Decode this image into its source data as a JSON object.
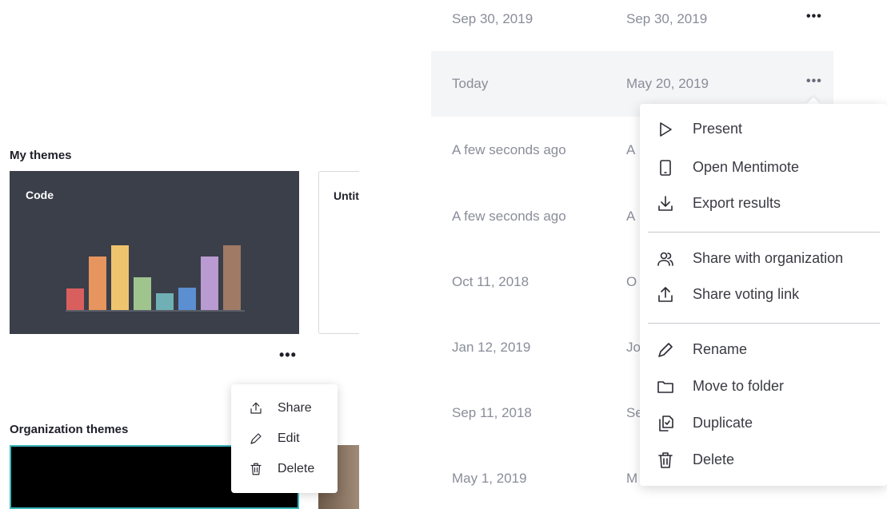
{
  "left": {
    "my_themes_title": "My themes",
    "org_themes_title": "Organization themes",
    "code_card": {
      "name": "Code"
    },
    "untitled_card": {
      "name": "Untitled"
    },
    "more": "•••",
    "small_menu": [
      {
        "label": "Share",
        "icon": "share-icon"
      },
      {
        "label": "Edit",
        "icon": "pencil-icon"
      },
      {
        "label": "Delete",
        "icon": "trash-icon"
      }
    ],
    "bar_colors": [
      "#d95f5f",
      "#e5955d",
      "#efc46e",
      "#9fc48e",
      "#6fb0b4",
      "#5b8fd1",
      "#b99ad1",
      "#a07a64"
    ]
  },
  "table": {
    "rows": [
      {
        "modified": "Sep 30, 2019",
        "created": "Sep 30, 2019"
      },
      {
        "modified": "Today",
        "created": "May 20, 2019"
      },
      {
        "modified": "A few seconds ago",
        "created": "A"
      },
      {
        "modified": "A few seconds ago",
        "created": "A"
      },
      {
        "modified": "Oct 11, 2018",
        "created": "O"
      },
      {
        "modified": "Jan 12, 2019",
        "created": "Jo"
      },
      {
        "modified": "Sep 11, 2018",
        "created": "Se"
      },
      {
        "modified": "May 1, 2019",
        "created": "M"
      }
    ],
    "more": "•••"
  },
  "context_menu": [
    {
      "label": "Present",
      "icon": "play-icon"
    },
    {
      "label": "Open Mentimote",
      "icon": "mobile-icon"
    },
    {
      "label": "Export results",
      "icon": "download-icon"
    },
    {
      "label": "Share with organization",
      "icon": "users-icon"
    },
    {
      "label": "Share voting link",
      "icon": "share-icon"
    },
    {
      "label": "Rename",
      "icon": "pencil-icon"
    },
    {
      "label": "Move to folder",
      "icon": "folder-icon"
    },
    {
      "label": "Duplicate",
      "icon": "duplicate-icon"
    },
    {
      "label": "Delete",
      "icon": "trash-icon"
    }
  ]
}
